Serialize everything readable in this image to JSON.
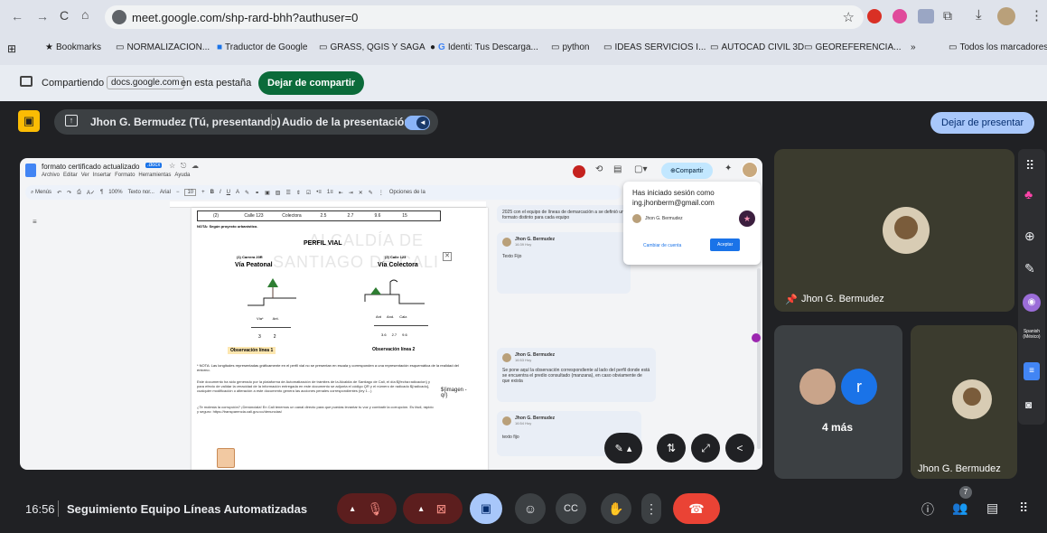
{
  "browser": {
    "url": "meet.google.com/shp-rard-bhh?authuser=0",
    "bookmarks": [
      "Bookmarks",
      "NORMALIZACION...",
      "Traductor de Google",
      "GRASS, QGIS Y SAGA",
      "Identi: Tus Descarga...",
      "python",
      "IDEAS SERVICIOS I...",
      "AUTOCAD CIVIL 3D",
      "GEOREFERENCIA..."
    ],
    "more": "»",
    "all_bookmarks": "Todos los marcadores"
  },
  "sharing": {
    "prefix": "Compartiendo",
    "site": "docs.google.com",
    "suffix": "en esta pestaña",
    "stop_button": "Dejar de compartir"
  },
  "presenter_bar": {
    "presenter": "Jhon G. Bermudez (Tú, presentando)",
    "audio_label": "Audio de la presentación",
    "stop_button": "Dejar de presentar"
  },
  "doc": {
    "title": "formato certificado actualizado",
    "ext": ".docx",
    "menus": [
      "Archivo",
      "Editar",
      "Ver",
      "Insertar",
      "Formato",
      "Herramientas",
      "Ayuda"
    ],
    "toolbar": {
      "search": "Menús",
      "zoom": "100%",
      "style": "Texto nor...",
      "font": "Arial",
      "size": "10"
    },
    "share_button": "Compartir",
    "options": "Opciones de la",
    "table_row": [
      "(2)",
      "Calle 123",
      "Colectora",
      "2.5",
      "2.7",
      "9.6",
      "15"
    ],
    "note_top": "NOTA: Según proyecto urbanístico.",
    "watermark1": "ALCALDÍA DE",
    "watermark2": "SANTIAGO DE CALI",
    "section_title": "PERFIL VIAL",
    "left_road": "(1) Carrera 20R",
    "left_label": "Vía Peatonal",
    "right_road": "(2) Calle 123",
    "right_label": "Vía Colectora",
    "left_parts": [
      "Vía*",
      "Ant."
    ],
    "right_parts": [
      "Ant",
      "And.",
      "Calz."
    ],
    "left_dims": [
      "3",
      "2"
    ],
    "right_dims": [
      "3.6",
      "2.7",
      "9.6"
    ],
    "obs1": "Observación línea 1",
    "obs2": "Observación línea 2",
    "note_body": "* NOTA: Las longitudes representadas gráficamente en el perfil vial no se presentan en escala y corresponden a una representación esquemática de la realidad del entorno.",
    "paragraph": "Este documento ha sido generado por la plataforma de Automatización de trámites de la Alcaldía de Santiago de Cali, el día ${fecha:radicacion} y para efecto de validar la veracidad de la información entregada en este documento se adjunta el código QR y el número de radicado ${radicado}, cualquier modificación o alteración a este documento genera las acciones penales correspondientes (ley 1...)",
    "paragraph2": "¿Te molesta la corrupción? ¡Denúnciala! En Cali tenemos un canal directo para que puedas levantar tu voz y combatir la corrupción. Es fácil, rápido y seguro: https://transparencia.cali.gov.co/denuncias/",
    "image_placeholder": "${imagen -qr}"
  },
  "comments": [
    {
      "text": "2025 con el equipo de líneas de demarcación a se definió un formato distinto para cada equipo"
    },
    {
      "author": "Jhon G. Bermudez",
      "time": "16:39 Hoy",
      "text": "Texto Fijo"
    },
    {
      "author": "Jhon G. Bermudez",
      "time": "16:53 Hoy",
      "text": "Se pone aquí la observación correspondiente al lado del perfil donde está se encuentra el predio consultado (manzana), en caso obviamente de que exista"
    },
    {
      "author": "Jhon G. Bermudez",
      "time": "16:54 Hoy",
      "text": "texto fijo"
    }
  ],
  "account_popup": {
    "title": "Has iniciado sesión como",
    "email": "ing.jhonberm@gmail.com",
    "name": "Jhon G. Bermudez",
    "switch": "Cambiar de cuenta",
    "accept": "Aceptar"
  },
  "participants": {
    "main_tile": "Jhon G. Bermudez",
    "more_count": "4 más",
    "more_initial": "r",
    "bottom_tile": "Jhon G. Bermudez"
  },
  "side_panel": {
    "caption_lang": "Spanish (México)"
  },
  "bottom_bar": {
    "time": "16:56",
    "meeting_title": "Seguimiento Equipo Líneas Automatizadas",
    "people_badge": "7"
  },
  "colors": {
    "accent": "#8ab4f8",
    "hangup": "#ea4335",
    "muted": "#5c1e1e",
    "yellow": "#fbbc04"
  }
}
